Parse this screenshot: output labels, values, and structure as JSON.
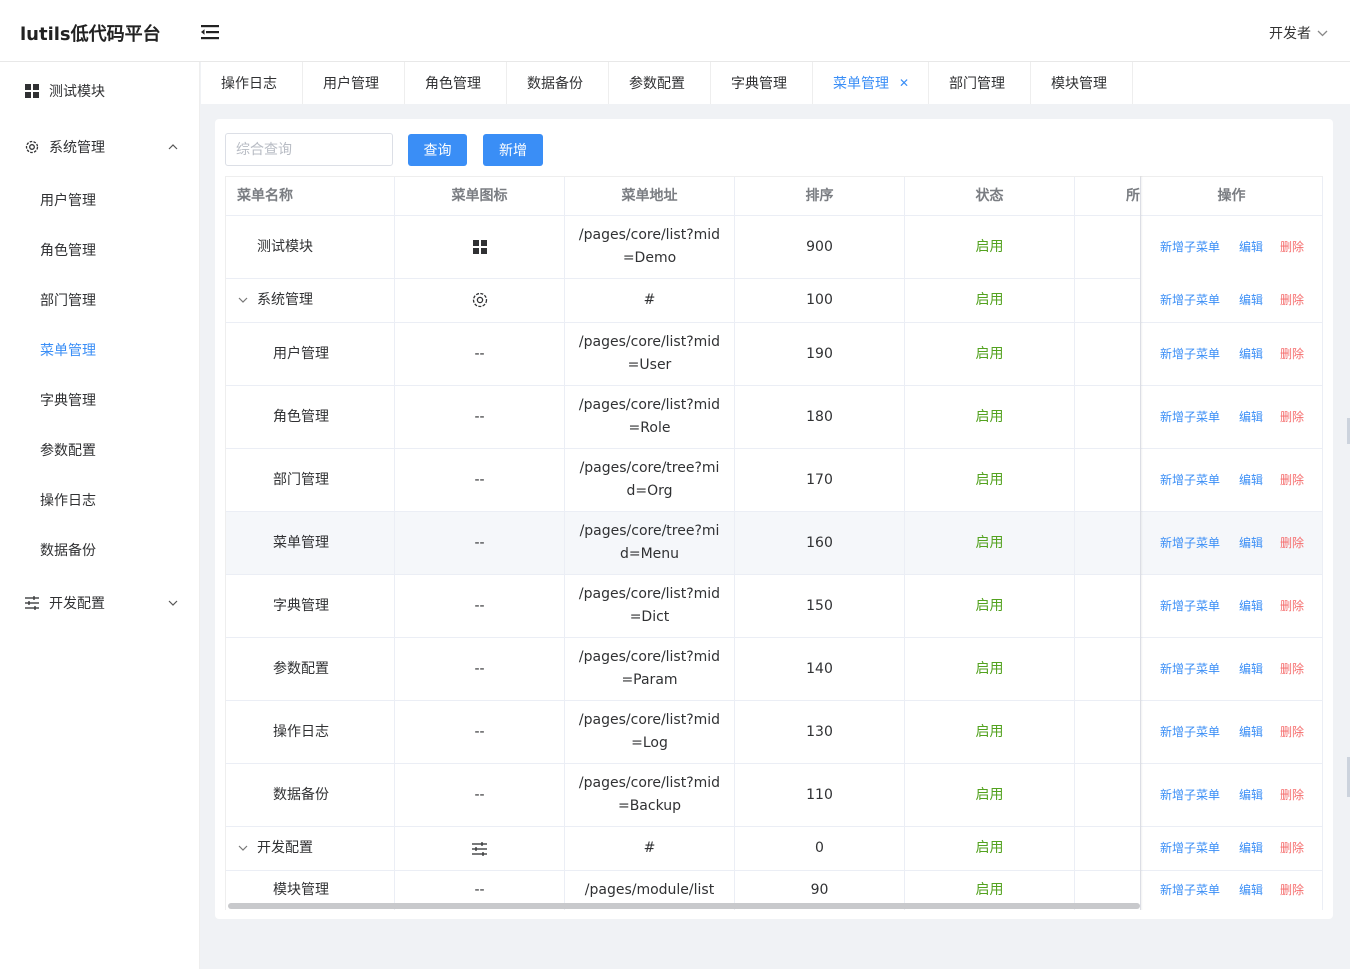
{
  "app": {
    "title": "lutils低代码平台",
    "user": "开发者"
  },
  "sidebar": {
    "items": [
      {
        "label": "测试模块",
        "icon": "grid-icon"
      },
      {
        "label": "系统管理",
        "icon": "gear-icon",
        "expanded": true
      },
      {
        "label": "开发配置",
        "icon": "sliders-icon",
        "expanded": false
      }
    ],
    "sub_items": [
      "用户管理",
      "角色管理",
      "部门管理",
      "菜单管理",
      "字典管理",
      "参数配置",
      "操作日志",
      "数据备份"
    ],
    "active": "菜单管理"
  },
  "tabs": [
    "操作日志",
    "用户管理",
    "角色管理",
    "数据备份",
    "参数配置",
    "字典管理",
    "菜单管理",
    "部门管理",
    "模块管理"
  ],
  "active_tab": "菜单管理",
  "toolbar": {
    "search_placeholder": "综合查询",
    "search_value": "",
    "query_label": "查询",
    "add_label": "新增"
  },
  "table": {
    "columns": [
      "菜单名称",
      "菜单图标",
      "菜单地址",
      "排序",
      "状态",
      "所",
      "操作"
    ],
    "actions": {
      "add_child": "新增子菜单",
      "edit": "编辑",
      "delete": "删除"
    },
    "rows": [
      {
        "name": "测试模块",
        "icon": "grid-icon",
        "url1": "/pages/core/list?mid",
        "url2": "=Demo",
        "sort": "900",
        "status": "启用"
      },
      {
        "name": "系统管理",
        "icon": "gear-icon",
        "url1": "#",
        "url2": "",
        "sort": "100",
        "status": "启用",
        "expand": true
      },
      {
        "name": "用户管理",
        "icon": "--",
        "url1": "/pages/core/list?mid",
        "url2": "=User",
        "sort": "190",
        "status": "启用"
      },
      {
        "name": "角色管理",
        "icon": "--",
        "url1": "/pages/core/list?mid",
        "url2": "=Role",
        "sort": "180",
        "status": "启用"
      },
      {
        "name": "部门管理",
        "icon": "--",
        "url1": "/pages/core/tree?mi",
        "url2": "d=Org",
        "sort": "170",
        "status": "启用"
      },
      {
        "name": "菜单管理",
        "icon": "--",
        "url1": "/pages/core/tree?mi",
        "url2": "d=Menu",
        "sort": "160",
        "status": "启用"
      },
      {
        "name": "字典管理",
        "icon": "--",
        "url1": "/pages/core/list?mid",
        "url2": "=Dict",
        "sort": "150",
        "status": "启用"
      },
      {
        "name": "参数配置",
        "icon": "--",
        "url1": "/pages/core/list?mid",
        "url2": "=Param",
        "sort": "140",
        "status": "启用"
      },
      {
        "name": "操作日志",
        "icon": "--",
        "url1": "/pages/core/list?mid",
        "url2": "=Log",
        "sort": "130",
        "status": "启用"
      },
      {
        "name": "数据备份",
        "icon": "--",
        "url1": "/pages/core/list?mid",
        "url2": "=Backup",
        "sort": "110",
        "status": "启用"
      },
      {
        "name": "开发配置",
        "icon": "sliders-icon",
        "url1": "#",
        "url2": "",
        "sort": "0",
        "status": "启用",
        "expand": true
      },
      {
        "name": "模块管理",
        "icon": "--",
        "url1": "/pages/module/list",
        "url2": "",
        "sort": "90",
        "status": "启用"
      }
    ]
  },
  "colors": {
    "accent": "#3a8ef6",
    "success": "#53a21f",
    "danger": "#f56c6c"
  }
}
